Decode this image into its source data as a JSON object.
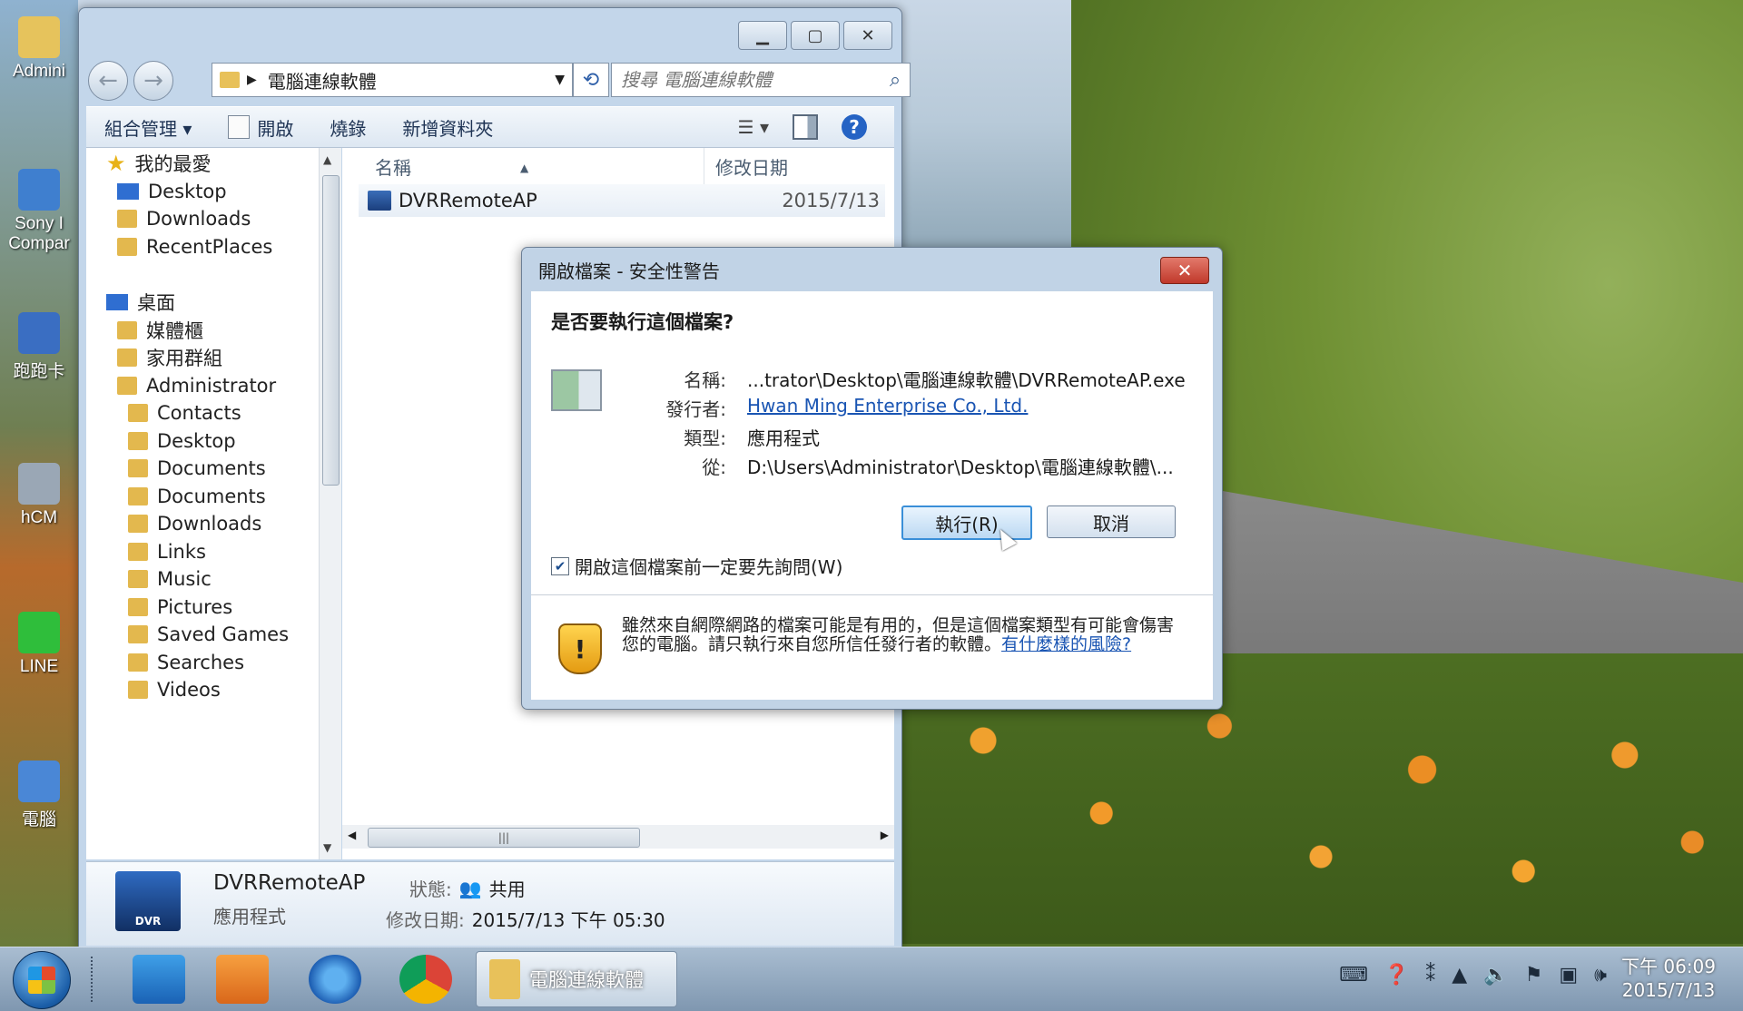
{
  "desktop": {
    "icons": [
      {
        "label": "Admini",
        "color": "#e6c35c"
      },
      {
        "label": "Sony I\nCompar",
        "color": "#3f7fcf"
      },
      {
        "label": "跑跑卡",
        "color": "#3a6ec2"
      },
      {
        "label": "hCM",
        "color": "#9aa7b5"
      },
      {
        "label": "LINE",
        "color": "#2fbe3b"
      },
      {
        "label": "電腦",
        "color": "#4a87d6"
      }
    ]
  },
  "explorer": {
    "address_path": "電腦連線軟體",
    "search_placeholder": "搜尋 電腦連線軟體",
    "toolbar": {
      "organize": "組合管理 ▾",
      "open": "開啟",
      "burn": "燒錄",
      "new_folder": "新增資料夾"
    },
    "nav_items": [
      {
        "label": "我的最愛",
        "icon": "star-icon",
        "indent": 0
      },
      {
        "label": "Desktop",
        "icon": "desktop-icon",
        "indent": 1
      },
      {
        "label": "Downloads",
        "icon": "folder-icon",
        "indent": 1
      },
      {
        "label": "RecentPlaces",
        "icon": "recent-places-icon",
        "indent": 1
      },
      {
        "label": "桌面",
        "icon": "desktop-icon",
        "indent": 0
      },
      {
        "label": "媒體櫃",
        "icon": "libraries-icon",
        "indent": 1
      },
      {
        "label": "家用群組",
        "icon": "homegroup-icon",
        "indent": 1
      },
      {
        "label": "Administrator",
        "icon": "user-folder-icon",
        "indent": 1
      },
      {
        "label": "Contacts",
        "icon": "folder-icon",
        "indent": 2
      },
      {
        "label": "Desktop",
        "icon": "folder-icon",
        "indent": 2
      },
      {
        "label": "Documents",
        "icon": "folder-icon",
        "indent": 2
      },
      {
        "label": "Documents",
        "icon": "folder-icon",
        "indent": 2
      },
      {
        "label": "Downloads",
        "icon": "folder-icon",
        "indent": 2
      },
      {
        "label": "Links",
        "icon": "folder-icon",
        "indent": 2
      },
      {
        "label": "Music",
        "icon": "folder-icon",
        "indent": 2
      },
      {
        "label": "Pictures",
        "icon": "folder-icon",
        "indent": 2
      },
      {
        "label": "Saved Games",
        "icon": "folder-icon",
        "indent": 2
      },
      {
        "label": "Searches",
        "icon": "folder-icon",
        "indent": 2
      },
      {
        "label": "Videos",
        "icon": "folder-icon",
        "indent": 2
      }
    ],
    "columns": {
      "name": "名稱",
      "modified": "修改日期"
    },
    "files": [
      {
        "name": "DVRRemoteAP",
        "date": "2015/7/13"
      }
    ],
    "details": {
      "name": "DVRRemoteAP",
      "type": "應用程式",
      "status_label": "狀態:",
      "status_value": "共用",
      "modified_label": "修改日期:",
      "modified_value": "2015/7/13 下午 05:30",
      "icon_text": "DVR"
    }
  },
  "dialog": {
    "title": "開啟檔案 - 安全性警告",
    "question": "是否要執行這個檔案?",
    "fields": [
      {
        "key": "名稱:",
        "value": "...trator\\Desktop\\電腦連線軟體\\DVRRemoteAP.exe",
        "link": false
      },
      {
        "key": "發行者:",
        "value": "Hwan Ming Enterprise Co., Ltd.",
        "link": true
      },
      {
        "key": "類型:",
        "value": "應用程式",
        "link": false
      },
      {
        "key": "從:",
        "value": "D:\\Users\\Administrator\\Desktop\\電腦連線軟體\\...",
        "link": false
      }
    ],
    "run_button": "執行(R)",
    "cancel_button": "取消",
    "checkbox_label": "開啟這個檔案前一定要先詢問(W)",
    "checkbox_checked": true,
    "warning_text": "雖然來自網際網路的檔案可能是有用的，但是這個檔案類型有可能會傷害您的電腦。請只執行來自您所信任發行者的軟體。",
    "warning_link": "有什麼樣的風險?"
  },
  "taskbar": {
    "active_task": "電腦連線軟體",
    "clock_time": "下午 06:09",
    "clock_date": "2015/7/13"
  }
}
